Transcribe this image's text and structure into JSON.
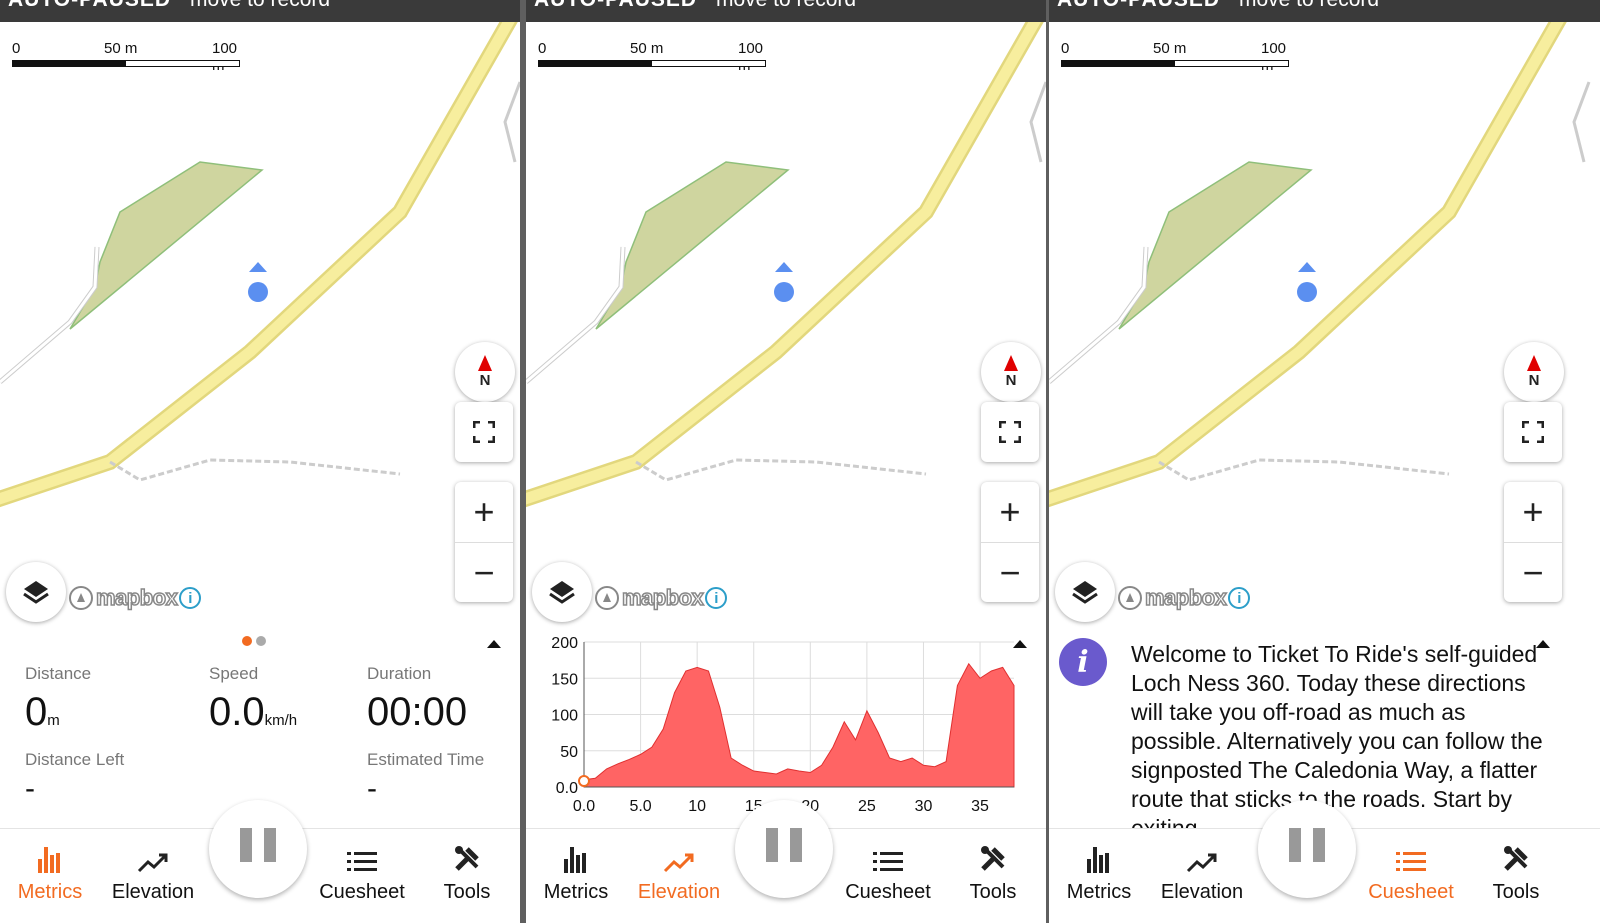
{
  "status_bar": {
    "state": "AUTO-PAUSED",
    "hint": "move to record"
  },
  "map": {
    "scale": {
      "start": "0",
      "mid": "50 m",
      "end": "100 m"
    },
    "compass_label": "N",
    "zoom_in": "+",
    "zoom_out": "−",
    "attribution": "mapbox",
    "attribution_info": "i",
    "colors": {
      "road_fill": "#f7ee9e",
      "road_border": "#e2d77d",
      "area": "#cfd59f",
      "area_border": "#8fbf7a",
      "location": "#5b8ff0"
    }
  },
  "metrics": {
    "distance_label": "Distance",
    "distance_value": "0",
    "distance_unit": "m",
    "speed_label": "Speed",
    "speed_value": "0.0",
    "speed_unit": "km/h",
    "duration_label": "Duration",
    "duration_value": "00:00",
    "distance_left_label": "Distance Left",
    "distance_left_value": "-",
    "estimated_time_label": "Estimated Time",
    "estimated_time_value": "-"
  },
  "cuesheet": {
    "text": "Welcome to Ticket To Ride's self-guided Loch Ness 360. Today these directions will take you off-road as much as possible. Alternatively you can follow the signposted The Caledonia Way, a flatter route that sticks to the roads. Start by exiting"
  },
  "nav": {
    "metrics": "Metrics",
    "elevation": "Elevation",
    "cuesheet": "Cuesheet",
    "tools": "Tools",
    "active_color": "#f26b21"
  },
  "chart_data": {
    "type": "area",
    "title": "",
    "xlabel": "",
    "ylabel": "",
    "xlim": [
      0,
      38
    ],
    "ylim": [
      0,
      200
    ],
    "x_ticks": [
      "0.0",
      "5.0",
      "10",
      "15",
      "20",
      "25",
      "30",
      "35"
    ],
    "y_ticks": [
      "0.0",
      "50",
      "100",
      "150",
      "200"
    ],
    "fill_color": "#ff6464",
    "x": [
      0,
      1,
      2,
      3,
      4,
      5,
      6,
      7,
      8,
      9,
      10,
      11,
      12,
      13,
      14,
      15,
      16,
      17,
      18,
      19,
      20,
      21,
      22,
      23,
      24,
      25,
      26,
      27,
      28,
      29,
      30,
      31,
      32,
      33,
      34,
      35,
      36,
      37,
      38
    ],
    "y": [
      10,
      12,
      25,
      32,
      38,
      45,
      55,
      80,
      130,
      160,
      165,
      160,
      110,
      40,
      30,
      22,
      20,
      18,
      25,
      22,
      20,
      30,
      55,
      90,
      65,
      105,
      75,
      40,
      35,
      40,
      30,
      28,
      35,
      140,
      170,
      150,
      160,
      165,
      140
    ]
  }
}
